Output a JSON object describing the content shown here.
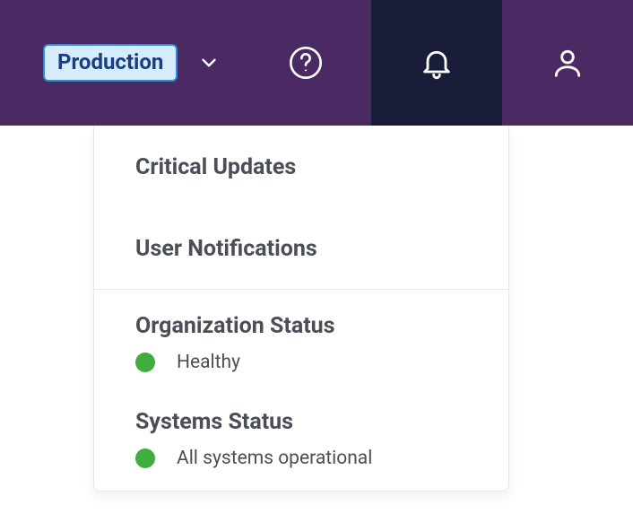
{
  "header": {
    "environment_label": "Production"
  },
  "notifications": {
    "critical_updates_title": "Critical Updates",
    "user_notifications_title": "User Notifications",
    "organization_status": {
      "title": "Organization Status",
      "status_text": "Healthy",
      "status_color": "#3fae3f"
    },
    "systems_status": {
      "title": "Systems Status",
      "status_text": "All systems operational",
      "status_color": "#3fae3f"
    }
  }
}
